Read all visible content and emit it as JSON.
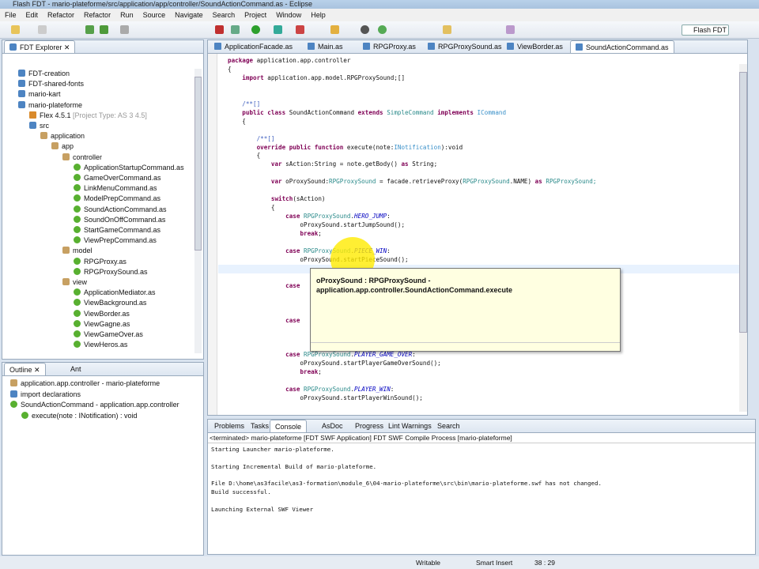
{
  "window": {
    "title": "Flash FDT - mario-plateforme/src/application/app/controller/SoundActionCommand.as - Eclipse"
  },
  "menu": [
    "File",
    "Edit",
    "Refactor",
    "Refactor",
    "Run",
    "Source",
    "Navigate",
    "Search",
    "Project",
    "Window",
    "Help"
  ],
  "perspective": "Flash FDT",
  "explorer": {
    "title": "FDT Explorer",
    "items": [
      {
        "label": "FDT-creation",
        "icon": "project-icon",
        "level": 0
      },
      {
        "label": "FDT-shared-fonts",
        "icon": "project-icon",
        "level": 0
      },
      {
        "label": "mario-kart",
        "icon": "project-icon",
        "level": 0
      },
      {
        "label": "mario-plateforme",
        "icon": "project-icon",
        "level": 0
      },
      {
        "label": "Flex 4.5.1",
        "suffix": "[Project Type: AS 3 4.5]",
        "icon": "flex-sdk-icon",
        "level": 1
      },
      {
        "label": "src",
        "icon": "source-folder-icon",
        "level": 1
      },
      {
        "label": "application",
        "icon": "package-icon",
        "level": 2
      },
      {
        "label": "app",
        "icon": "package-icon",
        "level": 3
      },
      {
        "label": "controller",
        "icon": "package-icon",
        "level": 4
      },
      {
        "label": "ApplicationStartupCommand.as",
        "icon": "class-icon",
        "level": 5
      },
      {
        "label": "GameOverCommand.as",
        "icon": "class-icon",
        "level": 5
      },
      {
        "label": "LinkMenuCommand.as",
        "icon": "class-icon",
        "level": 5
      },
      {
        "label": "ModelPrepCommand.as",
        "icon": "class-icon",
        "level": 5
      },
      {
        "label": "SoundActionCommand.as",
        "icon": "class-icon",
        "level": 5
      },
      {
        "label": "SoundOnOffCommand.as",
        "icon": "class-icon",
        "level": 5
      },
      {
        "label": "StartGameCommand.as",
        "icon": "class-icon",
        "level": 5
      },
      {
        "label": "ViewPrepCommand.as",
        "icon": "class-icon",
        "level": 5
      },
      {
        "label": "model",
        "icon": "package-icon",
        "level": 4
      },
      {
        "label": "RPGProxy.as",
        "icon": "class-icon",
        "level": 5
      },
      {
        "label": "RPGProxySound.as",
        "icon": "class-icon",
        "level": 5
      },
      {
        "label": "view",
        "icon": "package-icon",
        "level": 4
      },
      {
        "label": "ApplicationMediator.as",
        "icon": "class-icon",
        "level": 5
      },
      {
        "label": "ViewBackground.as",
        "icon": "class-icon",
        "level": 5
      },
      {
        "label": "ViewBorder.as",
        "icon": "class-icon",
        "level": 5
      },
      {
        "label": "ViewGagne.as",
        "icon": "class-icon",
        "level": 5
      },
      {
        "label": "ViewGameOver.as",
        "icon": "class-icon",
        "level": 5
      },
      {
        "label": "ViewHeros.as",
        "icon": "class-icon",
        "level": 5
      }
    ]
  },
  "outline": {
    "tabs": [
      "Outline",
      "Ant"
    ],
    "items": [
      {
        "label": "application.app.controller - mario-plateforme",
        "level": 0,
        "icon": "package-icon"
      },
      {
        "label": "import declarations",
        "level": 0,
        "icon": "import-icon"
      },
      {
        "label": "SoundActionCommand - application.app.controller",
        "level": 0,
        "icon": "class-icon"
      },
      {
        "label": "execute(note : INotification) : void",
        "level": 1,
        "icon": "method-icon"
      }
    ]
  },
  "editor": {
    "tabs": [
      "ApplicationFacade.as",
      "Main.as",
      "RPGProxy.as",
      "RPGProxySound.as",
      "ViewBorder.as",
      "SoundActionCommand.as"
    ],
    "lines": [
      [
        [
          "package",
          "kw"
        ],
        [
          " application.app.controller",
          ""
        ]
      ],
      [
        [
          "{",
          ""
        ]
      ],
      [
        [
          "    ",
          ""
        ],
        [
          "import",
          "kw"
        ],
        [
          " application.app.model.RPGProxySound;[]",
          ""
        ]
      ],
      [],
      [],
      [
        [
          "    /**[]",
          "cm"
        ]
      ],
      [
        [
          "    ",
          ""
        ],
        [
          "public class",
          "kw"
        ],
        [
          " SoundActionCommand ",
          ""
        ],
        [
          "extends",
          "kw"
        ],
        [
          " SimpleCommand ",
          "ty"
        ],
        [
          "implements",
          "kw"
        ],
        [
          " ICommand",
          "it"
        ]
      ],
      [
        [
          "    {",
          ""
        ]
      ],
      [],
      [
        [
          "        /**[]",
          "cm"
        ]
      ],
      [
        [
          "        ",
          ""
        ],
        [
          "override public function",
          "kw"
        ],
        [
          " execute(note:",
          ""
        ],
        [
          "INotification",
          "it"
        ],
        [
          "):void",
          ""
        ]
      ],
      [
        [
          "        {",
          ""
        ]
      ],
      [
        [
          "            ",
          ""
        ],
        [
          "var",
          "kw"
        ],
        [
          " sAction:String = note.getBody() ",
          ""
        ],
        [
          "as",
          "kw"
        ],
        [
          " String;",
          ""
        ]
      ],
      [],
      [
        [
          "            ",
          ""
        ],
        [
          "var",
          "kw"
        ],
        [
          " oProxySound:",
          ""
        ],
        [
          "RPGProxySound",
          "ty"
        ],
        [
          " = facade.retrieveProxy(",
          ""
        ],
        [
          "RPGProxySound",
          "ty"
        ],
        [
          ".NAME) ",
          ""
        ],
        [
          "as",
          "kw"
        ],
        [
          " RPGProxySound;",
          "ty"
        ]
      ],
      [],
      [
        [
          "            ",
          ""
        ],
        [
          "switch",
          "kw"
        ],
        [
          "(sAction)",
          ""
        ]
      ],
      [
        [
          "            {",
          ""
        ]
      ],
      [
        [
          "                ",
          ""
        ],
        [
          "case",
          "kw"
        ],
        [
          " RPGProxySound",
          "ty"
        ],
        [
          ".",
          ""
        ],
        [
          "HERO_JUMP",
          "cn"
        ],
        [
          ":",
          ""
        ]
      ],
      [
        [
          "                    oProxySound.startJumpSound();",
          ""
        ]
      ],
      [
        [
          "                    ",
          ""
        ],
        [
          "break",
          "kw"
        ],
        [
          ";",
          ""
        ]
      ],
      [],
      [
        [
          "                ",
          ""
        ],
        [
          "case",
          "kw"
        ],
        [
          " RPGProxySound",
          "ty"
        ],
        [
          ".",
          ""
        ],
        [
          "PIECE_WIN",
          "cn"
        ],
        [
          ":",
          ""
        ]
      ],
      [
        [
          "                    oProxySound.startPieceSound();",
          ""
        ]
      ],
      [],
      [],
      [
        [
          "                ",
          ""
        ],
        [
          "case",
          "kw"
        ]
      ],
      [],
      [],
      [],
      [
        [
          "                ",
          ""
        ],
        [
          "case",
          "kw"
        ]
      ],
      [],
      [],
      [],
      [
        [
          "                ",
          ""
        ],
        [
          "case",
          "kw"
        ],
        [
          " RPGProxySound",
          "ty"
        ],
        [
          ".",
          ""
        ],
        [
          "PLAYER_GAME_OVER",
          "cn"
        ],
        [
          ":",
          ""
        ]
      ],
      [
        [
          "                    oProxySound.startPlayerGameOverSound();",
          ""
        ]
      ],
      [
        [
          "                    ",
          ""
        ],
        [
          "break",
          "kw"
        ],
        [
          ";",
          ""
        ]
      ],
      [],
      [
        [
          "                ",
          ""
        ],
        [
          "case",
          "kw"
        ],
        [
          " RPGProxySound",
          "ty"
        ],
        [
          ".",
          ""
        ],
        [
          "PLAYER_WIN",
          "cn"
        ],
        [
          ":",
          ""
        ]
      ],
      [
        [
          "                    oProxySound.startPlayerWinSound();",
          ""
        ]
      ]
    ],
    "tooltip": {
      "line1": "oProxySound : RPGProxySound -",
      "line2": "application.app.controller.SoundActionCommand.execute"
    }
  },
  "console": {
    "tabs": [
      "Problems",
      "Tasks",
      "Console",
      "AsDoc",
      "Progress",
      "Lint Warnings",
      "Search"
    ],
    "header": "<terminated> mario-plateforme [FDT SWF Application] FDT SWF Compile Process [mario-plateforme]",
    "lines": [
      "Starting Launcher mario-plateforme.",
      "",
      "Starting Incremental Build of mario-plateforme.",
      "",
      "File D:\\home\\as3facile\\as3-formation\\module_6\\04-mario-plateforme\\src\\bin\\mario-plateforme.swf has not changed.",
      "Build successful.",
      "",
      "Launching External SWF Viewer"
    ]
  },
  "status": {
    "mode": "Writable",
    "insert": "Smart Insert",
    "position": "38 : 29"
  }
}
